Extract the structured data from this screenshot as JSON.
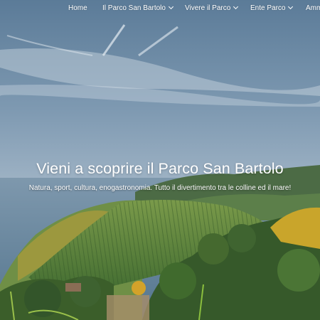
{
  "nav": {
    "items": [
      {
        "label": "Home",
        "has_dropdown": false
      },
      {
        "label": "Il Parco San Bartolo",
        "has_dropdown": true
      },
      {
        "label": "Vivere il Parco",
        "has_dropdown": true
      },
      {
        "label": "Ente Parco",
        "has_dropdown": true
      },
      {
        "label": "Amm",
        "has_dropdown": false
      }
    ]
  },
  "hero": {
    "title": "Vieni a scoprire il Parco San Bartolo",
    "subtitle": "Natura, sport, cultura, enogastronomia. Tutto il divertimento tra le colline ed il mare!"
  },
  "colors": {
    "sky_top": "#5f7f9c",
    "sky_bottom": "#b4c3d2",
    "sea": "#6d8aa3",
    "hill_green": "#4f7a3c",
    "nav_text": "#ffffff"
  }
}
